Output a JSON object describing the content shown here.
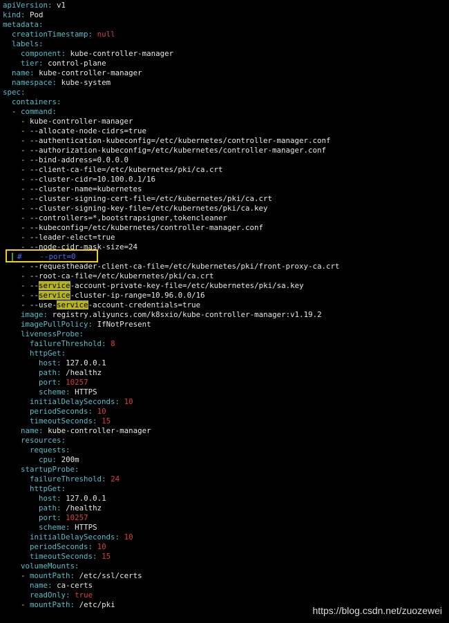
{
  "colors": {
    "background": "#000000",
    "key": "#4ec0cf",
    "value": "#e8e8e8",
    "number": "#e23b3b",
    "dash": "#e8d44d",
    "highlight": "#b5b21a",
    "comment": "#4a6cff",
    "box": "#f5d20a"
  },
  "lines": [
    {
      "indent": "",
      "dash": "",
      "key": "apiVersion",
      "value": "v1",
      "type": "val"
    },
    {
      "indent": "",
      "dash": "",
      "key": "kind",
      "value": "Pod",
      "type": "val"
    },
    {
      "indent": "",
      "dash": "",
      "key": "metadata",
      "value": "",
      "type": "val"
    },
    {
      "indent": "  ",
      "dash": "",
      "key": "creationTimestamp",
      "value": "null",
      "type": "num"
    },
    {
      "indent": "  ",
      "dash": "",
      "key": "labels",
      "value": "",
      "type": "val"
    },
    {
      "indent": "    ",
      "dash": "",
      "key": "component",
      "value": "kube-controller-manager",
      "type": "val"
    },
    {
      "indent": "    ",
      "dash": "",
      "key": "tier",
      "value": "control-plane",
      "type": "val"
    },
    {
      "indent": "  ",
      "dash": "",
      "key": "name",
      "value": "kube-controller-manager",
      "type": "val"
    },
    {
      "indent": "  ",
      "dash": "",
      "key": "namespace",
      "value": "kube-system",
      "type": "val"
    },
    {
      "indent": "",
      "dash": "",
      "key": "spec",
      "value": "",
      "type": "val"
    },
    {
      "indent": "  ",
      "dash": "",
      "key": "containers",
      "value": "",
      "type": "val"
    },
    {
      "indent": "  ",
      "dash": "- ",
      "key": "command",
      "value": "",
      "type": "val"
    },
    {
      "indent": "    ",
      "dash": "- ",
      "key": "",
      "value": "kube-controller-manager",
      "type": "item"
    },
    {
      "indent": "    ",
      "dash": "- ",
      "key": "",
      "value": "--allocate-node-cidrs=true",
      "type": "item"
    },
    {
      "indent": "    ",
      "dash": "- ",
      "key": "",
      "value": "--authentication-kubeconfig=/etc/kubernetes/controller-manager.conf",
      "type": "item"
    },
    {
      "indent": "    ",
      "dash": "- ",
      "key": "",
      "value": "--authorization-kubeconfig=/etc/kubernetes/controller-manager.conf",
      "type": "item"
    },
    {
      "indent": "    ",
      "dash": "- ",
      "key": "",
      "value": "--bind-address=0.0.0.0",
      "type": "item"
    },
    {
      "indent": "    ",
      "dash": "- ",
      "key": "",
      "value": "--client-ca-file=/etc/kubernetes/pki/ca.crt",
      "type": "item"
    },
    {
      "indent": "    ",
      "dash": "- ",
      "key": "",
      "value": "--cluster-cidr=10.100.0.1/16",
      "type": "item"
    },
    {
      "indent": "    ",
      "dash": "- ",
      "key": "",
      "value": "--cluster-name=kubernetes",
      "type": "item"
    },
    {
      "indent": "    ",
      "dash": "- ",
      "key": "",
      "value": "--cluster-signing-cert-file=/etc/kubernetes/pki/ca.crt",
      "type": "item"
    },
    {
      "indent": "    ",
      "dash": "- ",
      "key": "",
      "value": "--cluster-signing-key-file=/etc/kubernetes/pki/ca.key",
      "type": "item"
    },
    {
      "indent": "    ",
      "dash": "- ",
      "key": "",
      "value": "--controllers=*,bootstrapsigner,tokencleaner",
      "type": "item"
    },
    {
      "indent": "    ",
      "dash": "- ",
      "key": "",
      "value": "--kubeconfig=/etc/kubernetes/controller-manager.conf",
      "type": "item"
    },
    {
      "indent": "    ",
      "dash": "- ",
      "key": "",
      "value": "--leader-elect=true",
      "type": "item"
    },
    {
      "indent": "    ",
      "dash": "- ",
      "key": "",
      "value": "--node-cidr-mask-size=24",
      "type": "item"
    },
    {
      "indent": "  ",
      "dash": "",
      "key": "",
      "value": "#    --port=0",
      "type": "comment"
    },
    {
      "indent": "    ",
      "dash": "- ",
      "key": "",
      "value": "--requestheader-client-ca-file=/etc/kubernetes/pki/front-proxy-ca.crt",
      "type": "item"
    },
    {
      "indent": "    ",
      "dash": "- ",
      "key": "",
      "value": "--root-ca-file=/etc/kubernetes/pki/ca.crt",
      "type": "item"
    },
    {
      "indent": "    ",
      "dash": "- ",
      "key": "",
      "value": "--|service|-account-private-key-file=/etc/kubernetes/pki/sa.key",
      "type": "hl"
    },
    {
      "indent": "    ",
      "dash": "- ",
      "key": "",
      "value": "--|service|-cluster-ip-range=10.96.0.0/16",
      "type": "hl"
    },
    {
      "indent": "    ",
      "dash": "- ",
      "key": "",
      "value": "--use-|service|-account-credentials=true",
      "type": "hl"
    },
    {
      "indent": "    ",
      "dash": "",
      "key": "image",
      "value": "registry.aliyuncs.com/k8sxio/kube-controller-manager:v1.19.2",
      "type": "val"
    },
    {
      "indent": "    ",
      "dash": "",
      "key": "imagePullPolicy",
      "value": "IfNotPresent",
      "type": "val"
    },
    {
      "indent": "    ",
      "dash": "",
      "key": "livenessProbe",
      "value": "",
      "type": "val"
    },
    {
      "indent": "      ",
      "dash": "",
      "key": "failureThreshold",
      "value": "8",
      "type": "num"
    },
    {
      "indent": "      ",
      "dash": "",
      "key": "httpGet",
      "value": "",
      "type": "val"
    },
    {
      "indent": "        ",
      "dash": "",
      "key": "host",
      "value": "127.0.0.1",
      "type": "val"
    },
    {
      "indent": "        ",
      "dash": "",
      "key": "path",
      "value": "/healthz",
      "type": "val"
    },
    {
      "indent": "        ",
      "dash": "",
      "key": "port",
      "value": "10257",
      "type": "num"
    },
    {
      "indent": "        ",
      "dash": "",
      "key": "scheme",
      "value": "HTTPS",
      "type": "val"
    },
    {
      "indent": "      ",
      "dash": "",
      "key": "initialDelaySeconds",
      "value": "10",
      "type": "num"
    },
    {
      "indent": "      ",
      "dash": "",
      "key": "periodSeconds",
      "value": "10",
      "type": "num"
    },
    {
      "indent": "      ",
      "dash": "",
      "key": "timeoutSeconds",
      "value": "15",
      "type": "num"
    },
    {
      "indent": "    ",
      "dash": "",
      "key": "name",
      "value": "kube-controller-manager",
      "type": "val"
    },
    {
      "indent": "    ",
      "dash": "",
      "key": "resources",
      "value": "",
      "type": "val"
    },
    {
      "indent": "      ",
      "dash": "",
      "key": "requests",
      "value": "",
      "type": "val"
    },
    {
      "indent": "        ",
      "dash": "",
      "key": "cpu",
      "value": "200m",
      "type": "val"
    },
    {
      "indent": "    ",
      "dash": "",
      "key": "startupProbe",
      "value": "",
      "type": "val"
    },
    {
      "indent": "      ",
      "dash": "",
      "key": "failureThreshold",
      "value": "24",
      "type": "num"
    },
    {
      "indent": "      ",
      "dash": "",
      "key": "httpGet",
      "value": "",
      "type": "val"
    },
    {
      "indent": "        ",
      "dash": "",
      "key": "host",
      "value": "127.0.0.1",
      "type": "val"
    },
    {
      "indent": "        ",
      "dash": "",
      "key": "path",
      "value": "/healthz",
      "type": "val"
    },
    {
      "indent": "        ",
      "dash": "",
      "key": "port",
      "value": "10257",
      "type": "num"
    },
    {
      "indent": "        ",
      "dash": "",
      "key": "scheme",
      "value": "HTTPS",
      "type": "val"
    },
    {
      "indent": "      ",
      "dash": "",
      "key": "initialDelaySeconds",
      "value": "10",
      "type": "num"
    },
    {
      "indent": "      ",
      "dash": "",
      "key": "periodSeconds",
      "value": "10",
      "type": "num"
    },
    {
      "indent": "      ",
      "dash": "",
      "key": "timeoutSeconds",
      "value": "15",
      "type": "num"
    },
    {
      "indent": "    ",
      "dash": "",
      "key": "volumeMounts",
      "value": "",
      "type": "val"
    },
    {
      "indent": "    ",
      "dash": "- ",
      "key": "mountPath",
      "value": "/etc/ssl/certs",
      "type": "val"
    },
    {
      "indent": "      ",
      "dash": "",
      "key": "name",
      "value": "ca-certs",
      "type": "val"
    },
    {
      "indent": "      ",
      "dash": "",
      "key": "readOnly",
      "value": "true",
      "type": "num"
    },
    {
      "indent": "    ",
      "dash": "- ",
      "key": "mountPath",
      "value": "/etc/pki",
      "type": "val"
    }
  ],
  "watermark": "https://blog.csdn.net/zuozewei"
}
